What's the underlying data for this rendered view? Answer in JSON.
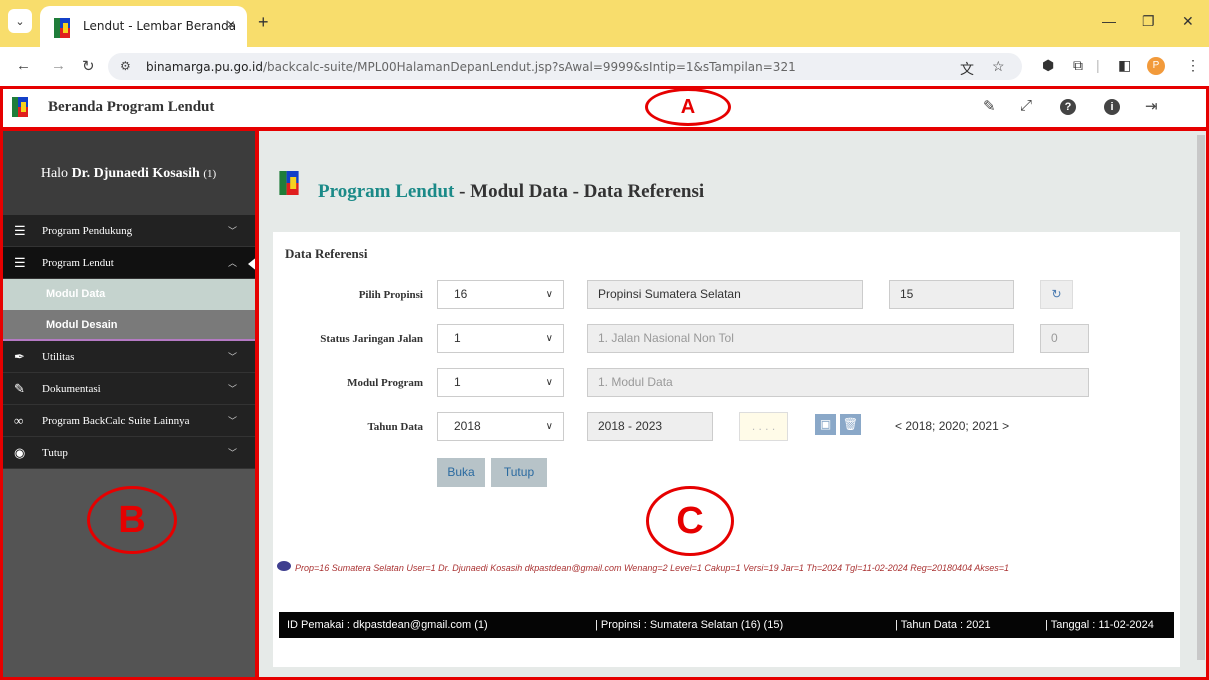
{
  "browser": {
    "tab_title": "Lendut - Lembar Beranda",
    "tab_close": "×",
    "new_tab": "+",
    "url_host": "binamarga.pu.go.id",
    "url_path": "/backcalc-suite/MPL00HalamanDepanLendut.jsp?sAwal=9999&sIntip=1&sTampilan=321",
    "profile_initial": "P"
  },
  "app": {
    "title": "Beranda Program Lendut",
    "header_icons": [
      "pencil-icon",
      "expand-icon",
      "question-icon",
      "info-icon",
      "logout-icon"
    ]
  },
  "sidebar": {
    "greeting": "Halo",
    "user_name": "Dr. Djunaedi Kosasih",
    "user_suffix": "(1)",
    "items": [
      {
        "label": "Program Pendukung",
        "icon": "list-icon"
      },
      {
        "label": "Program Lendut",
        "icon": "list-icon",
        "expanded": true
      },
      {
        "label": "Utilitas",
        "icon": "feather-icon"
      },
      {
        "label": "Dokumentasi",
        "icon": "pencil-icon"
      },
      {
        "label": "Program BackCalc Suite Lainnya",
        "icon": "link-icon"
      },
      {
        "label": "Tutup",
        "icon": "stop-icon"
      }
    ],
    "sub_items": [
      {
        "label": "Modul Data",
        "selected": true
      },
      {
        "label": "Modul Desain",
        "selected": false
      }
    ]
  },
  "main": {
    "title_accent": "Program Lendut",
    "title_rest": " - Modul Data - Data Referensi",
    "card_title": "Data Referensi",
    "fields": {
      "propinsi": {
        "label": "Pilih Propinsi",
        "value": "16",
        "name": "Propinsi Sumatera Selatan",
        "code": "15"
      },
      "status": {
        "label": "Status Jaringan Jalan",
        "value": "1",
        "name": "1. Jalan Nasional Non Tol",
        "code": "0"
      },
      "modul": {
        "label": "Modul Program",
        "value": "1",
        "name": "1. Modul Data"
      },
      "tahun": {
        "label": "Tahun Data",
        "value": "2018",
        "range": "2018 - 2023",
        "dots": ". . . .",
        "years": "< 2018; 2020; 2021 >"
      }
    },
    "buttons": {
      "open": "Buka",
      "close": "Tutup"
    },
    "info_line": "Prop=16 Sumatera Selatan  User=1 Dr. Djunaedi Kosasih dkpastdean@gmail.com  Wenang=2  Level=1  Cakup=1  Versi=19  Jar=1  Th=2024  Tgl=11-02-2024  Reg=20180404  Akses=1",
    "footer": {
      "user": "ID Pemakai : dkpastdean@gmail.com (1)",
      "province": "| Propinsi : Sumatera Selatan (16) (15)",
      "year": "| Tahun Data : 2021",
      "date": "| Tanggal : 11-02-2024"
    }
  },
  "annotations": {
    "a": "A",
    "b": "B",
    "c": "C",
    "color": "#e60000"
  }
}
